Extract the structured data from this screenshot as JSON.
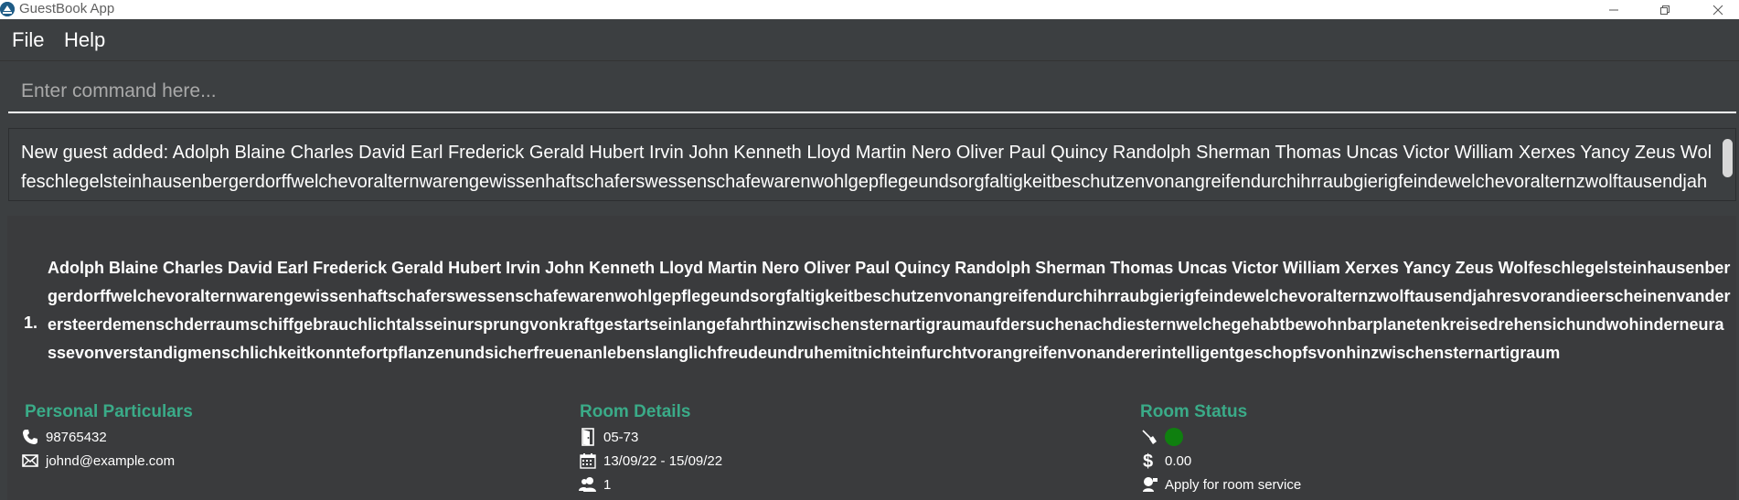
{
  "window": {
    "title": "GuestBook App"
  },
  "menu": {
    "file_label": "File",
    "help_label": "Help"
  },
  "command": {
    "placeholder": "Enter command here..."
  },
  "result": {
    "message": "New guest added: Adolph Blaine Charles David Earl Frederick Gerald Hubert Irvin John Kenneth Lloyd Martin Nero Oliver Paul Quincy Randolph Sherman Thomas Uncas Victor William Xerxes Yancy Zeus Wolfeschlegelsteinhausenbergerdorffwelchevoralternwarengewissenhaftschaferswessenschafewarenwohlgepflegeundsorgfaltigkeitbeschutzenvonangreifendurchihrraubgierigfeindewelchevoralternzwolftausendjahresvorandieerscheinenvanderersteerdemenschderraumschiffgebrauchlichtalsseinursprungvonkraftgestartseinlangefahrthinzwischensternartigraumaufdersuchenachdiesternwelchegehabtbewohnbar"
  },
  "guest": {
    "index": "1.",
    "name": "Adolph Blaine Charles David Earl Frederick Gerald Hubert Irvin John Kenneth Lloyd Martin Nero Oliver Paul Quincy Randolph Sherman Thomas Uncas Victor William Xerxes Yancy Zeus Wolfeschlegelsteinhausenbergerdorffwelchevoralternwarengewissenhaftschaferswessenschafewarenwohlgepflegeundsorgfaltigkeitbeschutzenvonangreifendurchihrraubgierigfeindewelchevoralternzwolftausendjahresvorandieerscheinenvanderersteerdemenschderraumschiffgebrauchlichtalsseinursprungvonkraftgestartseinlangefahrthinzwischensternartigraumaufdersuchenachdiesternwelchegehabtbewohnbarplanetenkreisedrehensichundwohinderneurassevonverstandigmenschlichkeitkonntefortpflanzenundsicherfreuenanlebenslanglichfreudeundruhemitnichteinfurchtvorangreifenvonandererintelligentgeschopfsvonhinzwischensternartigraum",
    "personal": {
      "title": "Personal Particulars",
      "phone": "98765432",
      "email": "johnd@example.com"
    },
    "room": {
      "title": "Room Details",
      "room_number": "05-73",
      "date_range": "13/09/22 - 15/09/22",
      "pax": "1"
    },
    "status": {
      "title": "Room Status",
      "clean_status_color": "#0f7f0f",
      "bill": "0.00",
      "service": "Apply for room service"
    }
  },
  "colors": {
    "background": "#3c3f41",
    "accent": "#3aab88",
    "text": "#ffffff"
  },
  "icons": {
    "app": "app-logo-icon",
    "minimize": "minimize-icon",
    "maximize": "maximize-icon",
    "close": "close-icon",
    "phone": "phone-icon",
    "email": "email-icon",
    "door": "door-icon",
    "calendar": "calendar-icon",
    "people": "people-icon",
    "broom": "broom-icon",
    "dollar": "dollar-icon",
    "service": "room-service-icon"
  }
}
